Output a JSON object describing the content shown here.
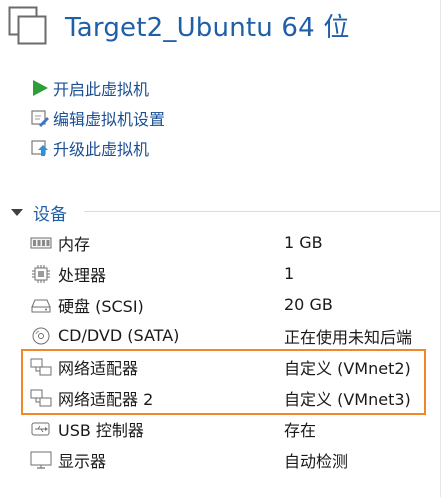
{
  "vm": {
    "title": "Target2_Ubuntu 64 位"
  },
  "actions": [
    {
      "label": "开启此虚拟机",
      "icon": "play-icon"
    },
    {
      "label": "编辑虚拟机设置",
      "icon": "edit-settings-icon"
    },
    {
      "label": "升级此虚拟机",
      "icon": "upgrade-icon"
    }
  ],
  "devices_section": {
    "label": "设备"
  },
  "devices": [
    {
      "name": "内存",
      "value": "1 GB",
      "icon": "memory-icon"
    },
    {
      "name": "处理器",
      "value": "1",
      "icon": "cpu-icon"
    },
    {
      "name": "硬盘 (SCSI)",
      "value": "20 GB",
      "icon": "hard-disk-icon"
    },
    {
      "name": "CD/DVD (SATA)",
      "value": "正在使用未知后端",
      "icon": "cd-dvd-icon"
    },
    {
      "name": "网络适配器",
      "value": "自定义 (VMnet2)",
      "icon": "network-adapter-icon"
    },
    {
      "name": "网络适配器 2",
      "value": "自定义 (VMnet3)",
      "icon": "network-adapter-icon"
    },
    {
      "name": "USB 控制器",
      "value": "存在",
      "icon": "usb-icon"
    },
    {
      "name": "显示器",
      "value": "自动检测",
      "icon": "monitor-icon"
    }
  ],
  "colors": {
    "accent": "#1f5fa8",
    "highlight": "#f0882a",
    "play": "#2e9e3a"
  }
}
